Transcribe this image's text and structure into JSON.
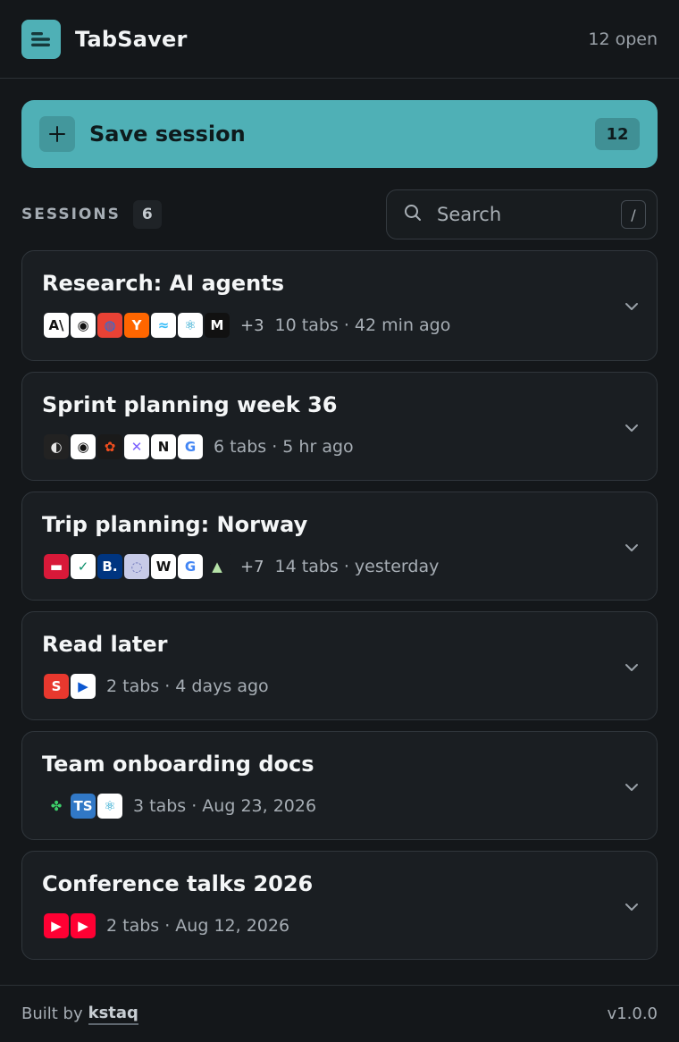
{
  "header": {
    "title": "TabSaver",
    "open_count": "12 open"
  },
  "save": {
    "label": "Save session",
    "count": "12"
  },
  "sessions_bar": {
    "label": "SESSIONS",
    "count": "6"
  },
  "search": {
    "placeholder": "Search",
    "shortcut": "/"
  },
  "sessions": [
    {
      "title": "Research: AI agents",
      "more": "+3",
      "meta": "10 tabs · 42 min ago",
      "favicons": [
        {
          "name": "anthropic-icon",
          "glyph": "A\\",
          "bg": "#ffffff",
          "fg": "#111111"
        },
        {
          "name": "github-icon",
          "glyph": "◉",
          "bg": "#ffffff",
          "fg": "#111111"
        },
        {
          "name": "chrome-icon",
          "glyph": "◍",
          "bg": "#e94235",
          "fg": "#1a73e8"
        },
        {
          "name": "ycombinator-icon",
          "glyph": "Y",
          "bg": "#ff6600",
          "fg": "#ffffff"
        },
        {
          "name": "tailwind-icon",
          "glyph": "≈",
          "bg": "#ffffff",
          "fg": "#38bdf8"
        },
        {
          "name": "react-icon",
          "glyph": "⚛",
          "bg": "#ffffff",
          "fg": "#149eca"
        },
        {
          "name": "medium-icon",
          "glyph": "M",
          "bg": "#111111",
          "fg": "#ffffff"
        }
      ]
    },
    {
      "title": "Sprint planning week 36",
      "more": "",
      "meta": "6 tabs · 5 hr ago",
      "favicons": [
        {
          "name": "linear-icon",
          "glyph": "◐",
          "bg": "#222222",
          "fg": "#e5e5e5"
        },
        {
          "name": "github-icon",
          "glyph": "◉",
          "bg": "#ffffff",
          "fg": "#111111"
        },
        {
          "name": "figma-icon",
          "glyph": "✿",
          "bg": "#1a1a1a",
          "fg": "#f24e1e"
        },
        {
          "name": "tools-icon",
          "glyph": "✕",
          "bg": "#ffffff",
          "fg": "#7b61ff"
        },
        {
          "name": "notion-icon",
          "glyph": "N",
          "bg": "#ffffff",
          "fg": "#111111"
        },
        {
          "name": "google-icon",
          "glyph": "G",
          "bg": "#ffffff",
          "fg": "#4285f4"
        }
      ]
    },
    {
      "title": "Trip planning: Norway",
      "more": "+7",
      "meta": "14 tabs · yesterday",
      "favicons": [
        {
          "name": "norwegian-icon",
          "glyph": "▬",
          "bg": "#d81939",
          "fg": "#ffffff"
        },
        {
          "name": "shield-check-icon",
          "glyph": "✓",
          "bg": "#ffffff",
          "fg": "#0a8f6a"
        },
        {
          "name": "booking-icon",
          "glyph": "B.",
          "bg": "#003580",
          "fg": "#ffffff"
        },
        {
          "name": "globe-icon",
          "glyph": "◌",
          "bg": "#c7cbe8",
          "fg": "#6a72b8"
        },
        {
          "name": "wikipedia-icon",
          "glyph": "W",
          "bg": "#ffffff",
          "fg": "#111111"
        },
        {
          "name": "google-icon",
          "glyph": "G",
          "bg": "#ffffff",
          "fg": "#4285f4"
        },
        {
          "name": "maps-icon",
          "glyph": "▲",
          "bg": "#1a1e22",
          "fg": "#b6e3a8"
        }
      ]
    },
    {
      "title": "Read later",
      "more": "",
      "meta": "2 tabs · 4 days ago",
      "favicons": [
        {
          "name": "substack-icon",
          "glyph": "S",
          "bg": "#e8382e",
          "fg": "#ffffff"
        },
        {
          "name": "play-arrow-icon",
          "glyph": "▶",
          "bg": "#ffffff",
          "fg": "#0b57d0"
        }
      ]
    },
    {
      "title": "Team onboarding docs",
      "more": "",
      "meta": "3 tabs · Aug 23, 2026",
      "favicons": [
        {
          "name": "puzzle-icon",
          "glyph": "✤",
          "bg": "#1a1e22",
          "fg": "#3dcf6a"
        },
        {
          "name": "typescript-icon",
          "glyph": "TS",
          "bg": "#3178c6",
          "fg": "#ffffff"
        },
        {
          "name": "react-icon",
          "glyph": "⚛",
          "bg": "#ffffff",
          "fg": "#149eca"
        }
      ]
    },
    {
      "title": "Conference talks 2026",
      "more": "",
      "meta": "2 tabs · Aug 12, 2026",
      "favicons": [
        {
          "name": "youtube-icon",
          "glyph": "▶",
          "bg": "#ff0033",
          "fg": "#ffffff"
        },
        {
          "name": "youtube-icon",
          "glyph": "▶",
          "bg": "#ff0033",
          "fg": "#ffffff"
        }
      ]
    }
  ],
  "footer": {
    "built_by": "Built by",
    "author": "kstaq",
    "version": "v1.0.0"
  },
  "colors": {
    "accent": "#4fb0b6",
    "background": "#14171a",
    "card": "#1a1e22"
  }
}
